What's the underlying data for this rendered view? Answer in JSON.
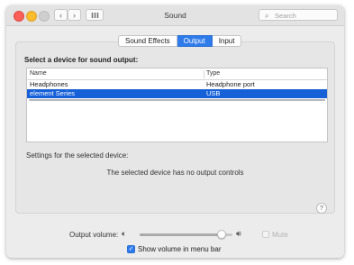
{
  "window": {
    "title": "Sound",
    "search_placeholder": "Search",
    "nav_back": "‹",
    "nav_forward": "›"
  },
  "tabs": [
    {
      "label": "Sound Effects",
      "active": false
    },
    {
      "label": "Output",
      "active": true
    },
    {
      "label": "Input",
      "active": false
    }
  ],
  "output": {
    "heading": "Select a device for sound output:",
    "columns": [
      "Name",
      "Type"
    ],
    "devices": [
      {
        "name": "Headphones",
        "type": "Headphone port",
        "selected": false
      },
      {
        "name": "element Series",
        "type": "USB",
        "selected": true
      }
    ],
    "settings_label": "Settings for the selected device:",
    "no_controls_message": "The selected device has no output controls",
    "help": "?"
  },
  "volume": {
    "label": "Output volume:",
    "level": 0.92,
    "mute_label": "Mute",
    "mute_checked": false,
    "show_in_menu_bar_label": "Show volume in menu bar",
    "show_in_menu_bar_checked": true
  },
  "colors": {
    "accent": "#2f7bea",
    "selection": "#1660d8",
    "close": "#fc5f57",
    "minimize": "#fdbc2e"
  },
  "icons": {
    "speaker_low": "speaker-low-icon",
    "speaker_high": "speaker-high-icon",
    "search": "search-icon",
    "grid": "grid-icon"
  }
}
